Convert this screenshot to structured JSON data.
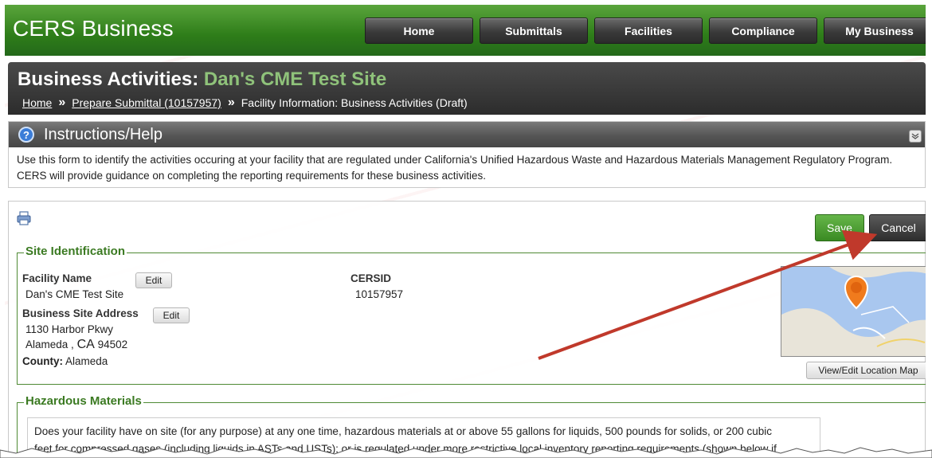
{
  "app": {
    "brand": "CERS Business"
  },
  "nav": {
    "items": [
      {
        "label": "Home"
      },
      {
        "label": "Submittals"
      },
      {
        "label": "Facilities"
      },
      {
        "label": "Compliance"
      },
      {
        "label": "My Business"
      }
    ]
  },
  "page": {
    "title_prefix": "Business Activities:",
    "title_site": "Dan's CME Test Site",
    "breadcrumb": [
      {
        "label": "Home",
        "link": true
      },
      {
        "label": "Prepare Submittal (10157957)",
        "link": true
      },
      {
        "label": "Facility Information: Business Activities (Draft)",
        "link": false
      }
    ],
    "breadcrumb_sep": "»"
  },
  "help": {
    "title": "Instructions/Help",
    "icon_glyph": "?",
    "collapse_glyph": "¥",
    "text": "Use this form to identify the activities occuring at your facility that are regulated under California's Unified Hazardous Waste and Hazardous Materials Management Regulatory Program. CERS will provide guidance on completing the reporting requirements for these business activities."
  },
  "form": {
    "save_label": "Save",
    "cancel_label": "Cancel",
    "site_identification": {
      "legend": "Site Identification",
      "facility_name_label": "Facility Name",
      "facility_name": "Dan's CME Test Site",
      "edit_label": "Edit",
      "cersid_label": "CERSID",
      "cersid": "10157957",
      "address_label": "Business Site Address",
      "address_line1": "1130 Harbor Pkwy",
      "city": "Alameda ,",
      "state": "CA",
      "zip": "94502",
      "county_label": "County:",
      "county": "Alameda",
      "map_button": "View/Edit Location Map"
    },
    "hazardous_materials": {
      "legend": "Hazardous Materials",
      "line1": "Does your facility have on site (for any purpose) at any one time, hazardous materials at or above 55 gallons for liquids, 500 pounds for solids, or 200 cubic",
      "line2": "feet for compressed gases (including liquids in ASTs and USTs); or is regulated under more restrictive local inventory reporting requirements (shown below if"
    }
  },
  "colors": {
    "brand_green": "#2e7d19",
    "legend_green": "#3b7a22",
    "title_site_green": "#8fc27a",
    "annotation_arrow": "#c0392b"
  }
}
